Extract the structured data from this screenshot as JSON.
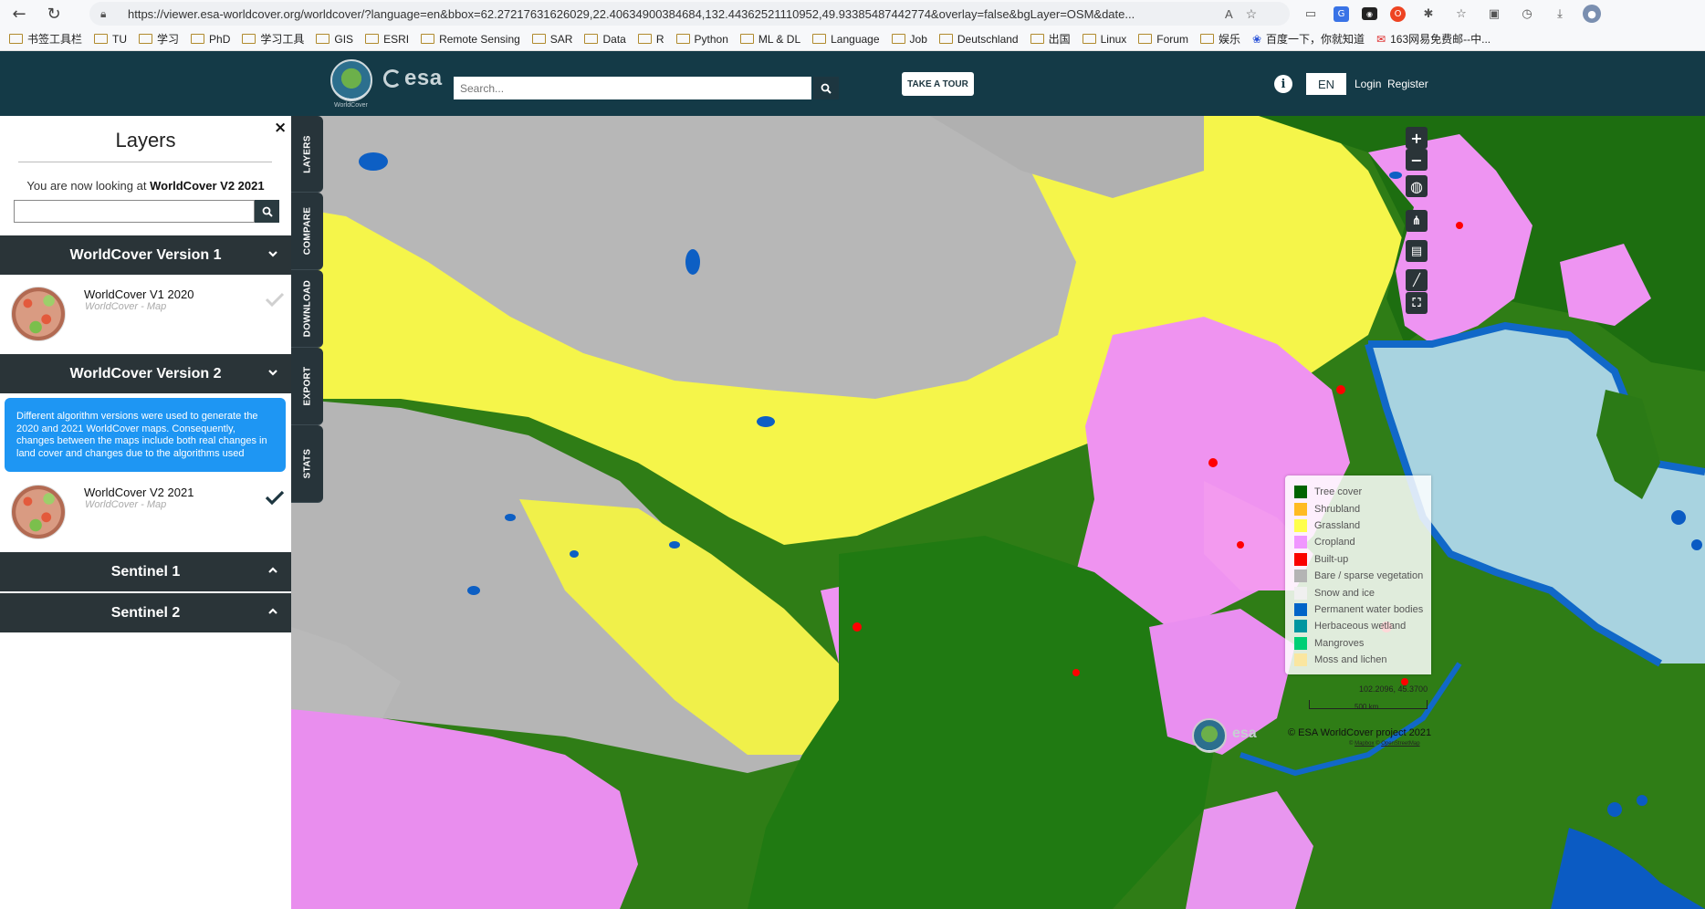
{
  "browser": {
    "url": "https://viewer.esa-worldcover.org/worldcover/?language=en&bbox=62.27217631626029,22.40634900384684,132.44362521110952,49.93385487442774&overlay=false&bgLayer=OSM&date...",
    "bookmarks": [
      "书签工具栏",
      "TU",
      "学习",
      "PhD",
      "学习工具",
      "GIS",
      "ESRI",
      "Remote Sensing",
      "SAR",
      "Data",
      "R",
      "Python",
      "ML & DL",
      "Language",
      "Job",
      "Deutschland",
      "出国",
      "Linux",
      "Forum",
      "娱乐"
    ],
    "bookmark_links": [
      "百度一下，你就知道",
      "163网易免费邮--中..."
    ]
  },
  "header": {
    "logo_caption": "WorldCover",
    "esa_text": "esa",
    "search_placeholder": "Search...",
    "tour_label": "TAKE A TOUR",
    "language": "EN",
    "login_label": "Login",
    "register_label": "Register"
  },
  "panel": {
    "close_label": "×",
    "title": "Layers",
    "looking_at_prefix": "You are now looking at",
    "current_layer": "WorldCover V2 2021",
    "groups": [
      {
        "title": "WorldCover Version 1",
        "expanded": true
      },
      {
        "title": "WorldCover Version 2",
        "expanded": true
      },
      {
        "title": "Sentinel 1",
        "expanded": false
      },
      {
        "title": "Sentinel 2",
        "expanded": false
      }
    ],
    "items": [
      {
        "name": "WorldCover V1 2020",
        "subtitle": "WorldCover - Map",
        "selected": false
      },
      {
        "name": "WorldCover V2 2021",
        "subtitle": "WorldCover - Map",
        "selected": true
      }
    ],
    "info_text": "Different algorithm versions were used to generate the 2020 and 2021 WorldCover maps. Consequently, changes between the maps include both real changes in land cover and changes due to the algorithms used"
  },
  "side_tabs": [
    "LAYERS",
    "COMPARE",
    "DOWNLOAD",
    "EXPORT",
    "STATS"
  ],
  "map": {
    "legend": [
      {
        "label": "Tree cover",
        "color": "#006400"
      },
      {
        "label": "Shrubland",
        "color": "#ffbb22"
      },
      {
        "label": "Grassland",
        "color": "#ffff4c"
      },
      {
        "label": "Cropland",
        "color": "#f096ff"
      },
      {
        "label": "Built-up",
        "color": "#fa0000"
      },
      {
        "label": "Bare / sparse vegetation",
        "color": "#b4b4b4"
      },
      {
        "label": "Snow and ice",
        "color": "#f0f0f0"
      },
      {
        "label": "Permanent water bodies",
        "color": "#0064c8"
      },
      {
        "label": "Herbaceous wetland",
        "color": "#0096a0"
      },
      {
        "label": "Mangroves",
        "color": "#00cf75"
      },
      {
        "label": "Moss and lichen",
        "color": "#fae6a0"
      }
    ],
    "coordinates": "102.2096, 45.3700",
    "scale_label": "500 km",
    "copyright": "© ESA WorldCover project 2021",
    "attribution_prefix": "©",
    "attribution_mapbox": "Mapbox",
    "attribution_mid": "©",
    "attribution_osm": "OpenStreetMap",
    "bottom_esa": "esa",
    "controls": [
      "zoom-in",
      "zoom-out",
      "globe",
      "share",
      "map",
      "ruler",
      "fullscreen"
    ]
  }
}
